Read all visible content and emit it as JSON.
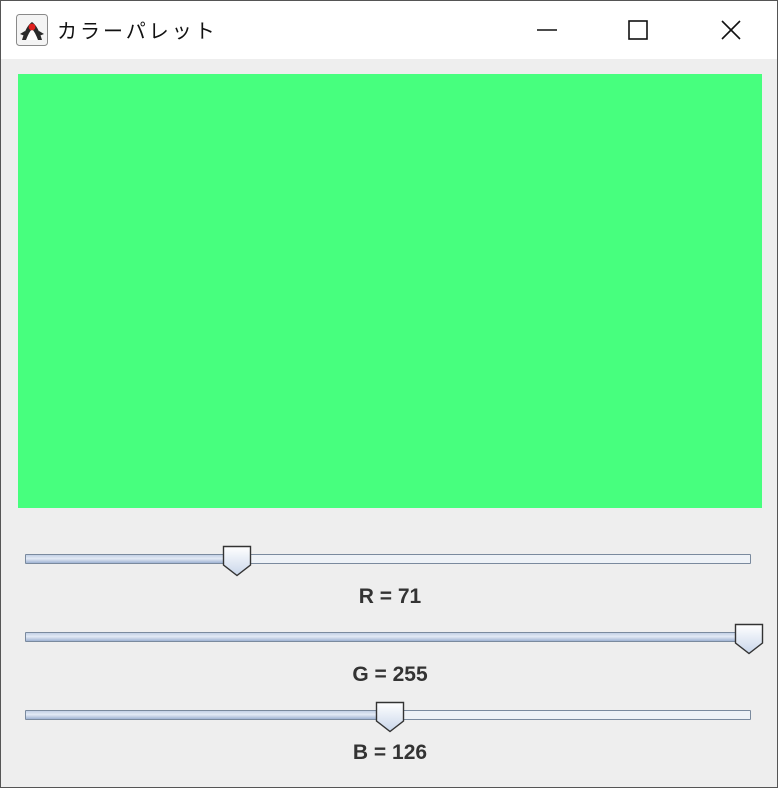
{
  "window": {
    "title": "カラーパレット",
    "app_icon": "java-duke-icon",
    "controls": [
      "minimize-icon",
      "maximize-icon",
      "close-icon"
    ]
  },
  "preview": {
    "color": "#47ff7e"
  },
  "sliders": [
    {
      "channel": "R",
      "label": "R = 71",
      "value": 71,
      "min": 0,
      "max": 255
    },
    {
      "channel": "G",
      "label": "G = 255",
      "value": 255,
      "min": 0,
      "max": 255
    },
    {
      "channel": "B",
      "label": "B = 126",
      "value": 126,
      "min": 0,
      "max": 255
    }
  ]
}
